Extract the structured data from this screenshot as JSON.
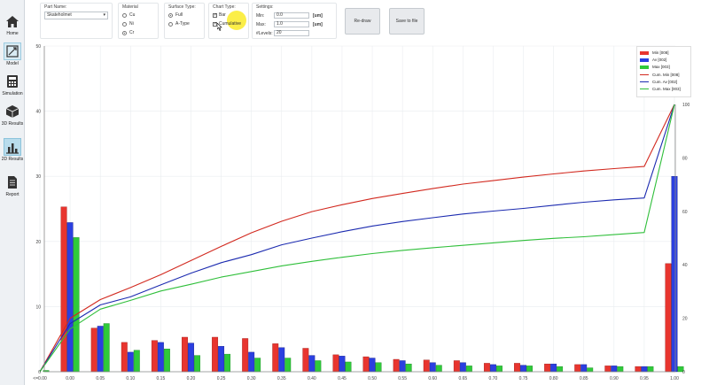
{
  "sidebar": {
    "items": [
      {
        "label": "Home",
        "icon": "home-icon"
      },
      {
        "label": "Model",
        "icon": "model-icon"
      },
      {
        "label": "Simulation",
        "icon": "calculator-icon"
      },
      {
        "label": "3D Results",
        "icon": "cube-icon"
      },
      {
        "label": "2D Results",
        "icon": "bar-chart-icon"
      },
      {
        "label": "Report",
        "icon": "document-icon"
      }
    ],
    "active": "2D Results"
  },
  "controls": {
    "part_name": {
      "title": "Part Name:",
      "value": "Skateholmet"
    },
    "material": {
      "title": "Material",
      "options": [
        "Cu",
        "Ni",
        "Cr"
      ],
      "selected": "Cr"
    },
    "surface_type": {
      "title": "Surface Type:",
      "options": [
        "Full",
        "A-Type"
      ],
      "selected": "Full"
    },
    "chart_type": {
      "title": "Chart Type:",
      "options": [
        {
          "label": "Bar",
          "checked": true
        },
        {
          "label": "Cumulative",
          "checked": true
        }
      ]
    },
    "settings": {
      "title": "Settings:",
      "min_label": "Min:",
      "min_value": "0.0",
      "min_unit": "[um]",
      "max_label": "Max:",
      "max_value": "1.0",
      "max_unit": "[um]",
      "levels_label": "#Levels:",
      "levels_value": "20"
    },
    "redraw_label": "Re-draw",
    "save_label": "Save to file"
  },
  "colors": {
    "min_bar": "#e8352f",
    "av_bar": "#2b3fe0",
    "max_bar": "#2fca3a",
    "cum_min": "#d2291f",
    "cum_av": "#1c2bb0",
    "cum_max": "#2fbf3a",
    "active_nav": "#b9dcec",
    "cursor_highlight": "#f7e51f"
  },
  "legend": [
    {
      "label": "Min [008]",
      "kind": "bar",
      "color": "#e8352f"
    },
    {
      "label": "Av [002]",
      "kind": "bar",
      "color": "#2b3fe0"
    },
    {
      "label": "Max [003]",
      "kind": "bar",
      "color": "#2fca3a"
    },
    {
      "label": "Cum. Min [008]",
      "kind": "line",
      "color": "#d2291f"
    },
    {
      "label": "Cum. Av [002]",
      "kind": "line",
      "color": "#1c2bb0"
    },
    {
      "label": "Cum. Max [003]",
      "kind": "line",
      "color": "#2fbf3a"
    }
  ],
  "chart_data": {
    "type": "bar",
    "categories": [
      "<=0.00",
      "0.00",
      "0.05",
      "0.10",
      "0.15",
      "0.20",
      "0.25",
      "0.30",
      "0.35",
      "0.40",
      "0.45",
      "0.50",
      "0.55",
      "0.60",
      "0.65",
      "0.70",
      "0.75",
      "0.80",
      "0.85",
      "0.90",
      "0.95",
      "1.00"
    ],
    "series": [
      {
        "name": "Min [008]",
        "values": [
          0,
          25.3,
          6.7,
          4.5,
          4.8,
          5.3,
          5.3,
          5.1,
          4.3,
          3.6,
          2.6,
          2.3,
          1.9,
          1.8,
          1.7,
          1.3,
          1.3,
          1.2,
          1.1,
          0.9,
          0.8,
          16.6
        ]
      },
      {
        "name": "Av [002]",
        "values": [
          0,
          22.9,
          7.0,
          3.0,
          4.5,
          4.4,
          3.9,
          3.0,
          3.7,
          2.5,
          2.4,
          2.1,
          1.7,
          1.4,
          1.4,
          1.1,
          1.0,
          1.2,
          1.1,
          0.9,
          0.8,
          30.0
        ]
      },
      {
        "name": "Max [003]",
        "values": [
          0.2,
          20.6,
          7.4,
          3.3,
          3.5,
          2.5,
          2.7,
          2.1,
          2.1,
          1.7,
          1.5,
          1.4,
          1.2,
          1.0,
          0.9,
          0.9,
          0.9,
          0.8,
          0.6,
          0.8,
          0.8,
          0.8
        ]
      }
    ],
    "cumulative_series": [
      {
        "name": "Cum. Min [008]",
        "values": [
          0,
          20,
          27,
          31.5,
          36.3,
          41.6,
          46.9,
          52,
          56.3,
          59.9,
          62.5,
          64.8,
          66.7,
          68.5,
          70.2,
          71.5,
          72.8,
          74,
          75.1,
          76,
          76.8,
          100
        ]
      },
      {
        "name": "Cum. Av [002]",
        "values": [
          0,
          18,
          25,
          28,
          32.5,
          36.9,
          40.8,
          43.8,
          47.5,
          50,
          52.4,
          54.5,
          56.2,
          57.6,
          59,
          60.1,
          61.1,
          62.3,
          63.4,
          64.3,
          65,
          100
        ]
      },
      {
        "name": "Cum. Max [003]",
        "values": [
          0,
          16,
          23.4,
          26.7,
          30.2,
          32.7,
          35.4,
          37.5,
          39.6,
          41.3,
          42.8,
          44.2,
          45.4,
          46.4,
          47.3,
          48.2,
          49.1,
          49.9,
          50.5,
          51.3,
          52.1,
          100
        ]
      }
    ],
    "ylim": [
      0,
      50
    ],
    "y_ticks": [
      0,
      10,
      20,
      30,
      40,
      50
    ],
    "y2lim": [
      0,
      100
    ],
    "y2_ticks": [
      0,
      20,
      40,
      60,
      80,
      100
    ],
    "grid": true,
    "legend_position": "top-right"
  }
}
